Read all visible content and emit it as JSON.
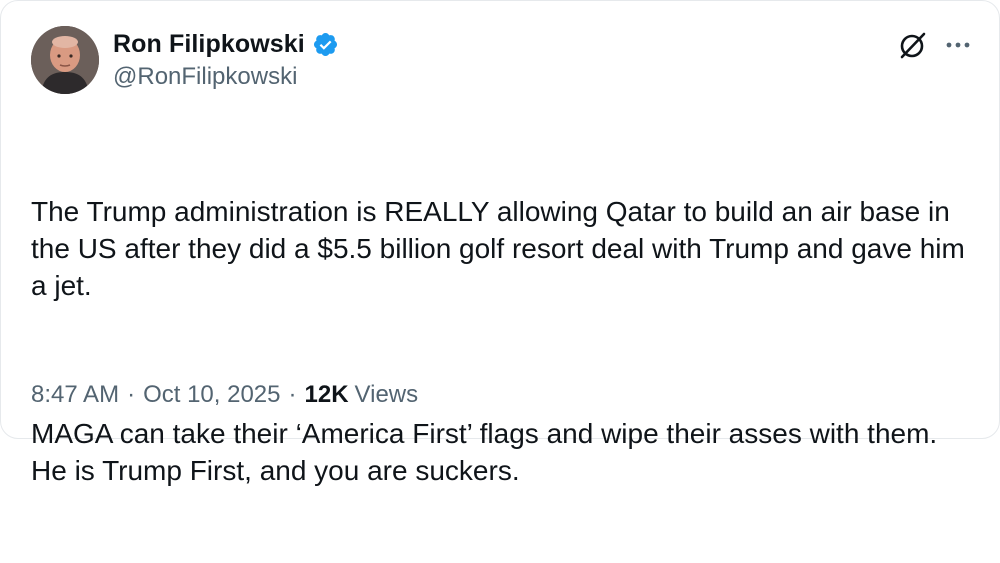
{
  "author": {
    "display_name": "Ron Filipkowski",
    "handle": "@RonFilipkowski",
    "verified": true,
    "verified_color": "#1d9bf0"
  },
  "icons": {
    "grok": "grok-icon",
    "more": "more-icon"
  },
  "tweet": {
    "paragraphs": [
      "The Trump administration is REALLY allowing Qatar to build an air base in the US after they did a $5.5 billion golf resort deal with Trump and gave him a jet.",
      "MAGA can take their ‘America First’ flags and wipe their asses with them. He is Trump First, and you are suckers."
    ]
  },
  "meta": {
    "time": "8:47 AM",
    "date": "Oct 10, 2025",
    "separator": "·",
    "views_count": "12K",
    "views_label": "Views"
  }
}
